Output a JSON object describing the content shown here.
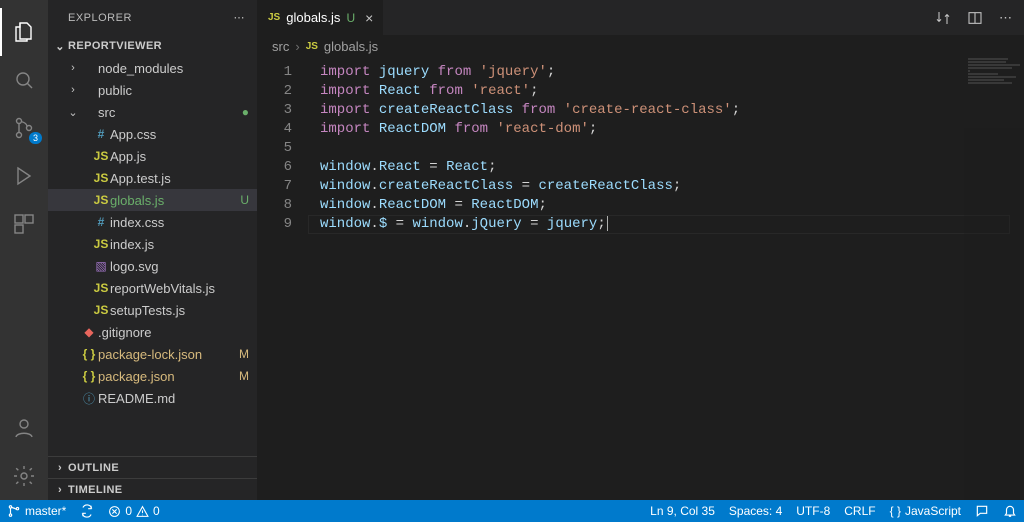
{
  "explorer": {
    "title": "EXPLORER",
    "workspace": "REPORTVIEWER",
    "outline": "OUTLINE",
    "timeline": "TIMELINE"
  },
  "tree": [
    {
      "id": "node_modules",
      "label": "node_modules",
      "type": "folder",
      "depth": 1,
      "expanded": false
    },
    {
      "id": "public",
      "label": "public",
      "type": "folder",
      "depth": 1,
      "expanded": false
    },
    {
      "id": "src",
      "label": "src",
      "type": "folder",
      "depth": 1,
      "expanded": true,
      "status": "dot-U"
    },
    {
      "id": "app-css",
      "label": "App.css",
      "type": "css",
      "depth": 2
    },
    {
      "id": "app-js",
      "label": "App.js",
      "type": "js",
      "depth": 2
    },
    {
      "id": "app-test-js",
      "label": "App.test.js",
      "type": "js",
      "depth": 2
    },
    {
      "id": "globals-js",
      "label": "globals.js",
      "type": "js",
      "depth": 2,
      "status": "U",
      "selected": true
    },
    {
      "id": "index-css",
      "label": "index.css",
      "type": "css",
      "depth": 2
    },
    {
      "id": "index-js",
      "label": "index.js",
      "type": "js",
      "depth": 2
    },
    {
      "id": "logo-svg",
      "label": "logo.svg",
      "type": "svg",
      "depth": 2
    },
    {
      "id": "reportwebvitals",
      "label": "reportWebVitals.js",
      "type": "js",
      "depth": 2
    },
    {
      "id": "setuptests",
      "label": "setupTests.js",
      "type": "js",
      "depth": 2
    },
    {
      "id": "gitignore",
      "label": ".gitignore",
      "type": "git",
      "depth": 1
    },
    {
      "id": "pkg-lock",
      "label": "package-lock.json",
      "type": "json",
      "depth": 1,
      "status": "M"
    },
    {
      "id": "pkg",
      "label": "package.json",
      "type": "json",
      "depth": 1,
      "status": "M"
    },
    {
      "id": "readme",
      "label": "README.md",
      "type": "md",
      "depth": 1
    }
  ],
  "iconGlyph": {
    "css": "#",
    "js": "JS",
    "json": "{ }",
    "svg": "▧",
    "git": "◆",
    "md": "ⓘ",
    "folder": ""
  },
  "activity": {
    "scmBadge": "3"
  },
  "tab": {
    "icon": "JS",
    "name": "globals.js",
    "status": "U"
  },
  "breadcrumb": {
    "folder": "src",
    "icon": "JS",
    "file": "globals.js"
  },
  "code": {
    "lines": [
      [
        {
          "t": "kw",
          "v": "import"
        },
        {
          "t": "sp"
        },
        {
          "t": "id",
          "v": "jquery"
        },
        {
          "t": "sp"
        },
        {
          "t": "kw",
          "v": "from"
        },
        {
          "t": "sp"
        },
        {
          "t": "str",
          "v": "'jquery'"
        },
        {
          "t": "punc",
          "v": ";"
        }
      ],
      [
        {
          "t": "kw",
          "v": "import"
        },
        {
          "t": "sp"
        },
        {
          "t": "id",
          "v": "React"
        },
        {
          "t": "sp"
        },
        {
          "t": "kw",
          "v": "from"
        },
        {
          "t": "sp"
        },
        {
          "t": "str",
          "v": "'react'"
        },
        {
          "t": "punc",
          "v": ";"
        }
      ],
      [
        {
          "t": "kw",
          "v": "import"
        },
        {
          "t": "sp"
        },
        {
          "t": "id",
          "v": "createReactClass"
        },
        {
          "t": "sp"
        },
        {
          "t": "kw",
          "v": "from"
        },
        {
          "t": "sp"
        },
        {
          "t": "str",
          "v": "'create-react-class'"
        },
        {
          "t": "punc",
          "v": ";"
        }
      ],
      [
        {
          "t": "kw",
          "v": "import"
        },
        {
          "t": "sp"
        },
        {
          "t": "id",
          "v": "ReactDOM"
        },
        {
          "t": "sp"
        },
        {
          "t": "kw",
          "v": "from"
        },
        {
          "t": "sp"
        },
        {
          "t": "str",
          "v": "'react-dom'"
        },
        {
          "t": "punc",
          "v": ";"
        }
      ],
      [],
      [
        {
          "t": "id",
          "v": "window"
        },
        {
          "t": "punc",
          "v": "."
        },
        {
          "t": "id",
          "v": "React"
        },
        {
          "t": "punc",
          "v": " = "
        },
        {
          "t": "id",
          "v": "React"
        },
        {
          "t": "punc",
          "v": ";"
        }
      ],
      [
        {
          "t": "id",
          "v": "window"
        },
        {
          "t": "punc",
          "v": "."
        },
        {
          "t": "id",
          "v": "createReactClass"
        },
        {
          "t": "punc",
          "v": " = "
        },
        {
          "t": "id",
          "v": "createReactClass"
        },
        {
          "t": "punc",
          "v": ";"
        }
      ],
      [
        {
          "t": "id",
          "v": "window"
        },
        {
          "t": "punc",
          "v": "."
        },
        {
          "t": "id",
          "v": "ReactDOM"
        },
        {
          "t": "punc",
          "v": " = "
        },
        {
          "t": "id",
          "v": "ReactDOM"
        },
        {
          "t": "punc",
          "v": ";"
        }
      ],
      [
        {
          "t": "id",
          "v": "window"
        },
        {
          "t": "punc",
          "v": "."
        },
        {
          "t": "id",
          "v": "$"
        },
        {
          "t": "punc",
          "v": " = "
        },
        {
          "t": "id",
          "v": "window"
        },
        {
          "t": "punc",
          "v": "."
        },
        {
          "t": "id",
          "v": "jQuery"
        },
        {
          "t": "punc",
          "v": " = "
        },
        {
          "t": "id",
          "v": "jquery"
        },
        {
          "t": "punc",
          "v": ";"
        },
        {
          "t": "caret"
        }
      ]
    ],
    "cursorLine": 9
  },
  "status": {
    "branch": "master*",
    "errors": "0",
    "warnings": "0",
    "position": "Ln 9, Col 35",
    "spaces": "Spaces: 4",
    "encoding": "UTF-8",
    "eol": "CRLF",
    "langIcon": "{ }",
    "lang": "JavaScript"
  }
}
